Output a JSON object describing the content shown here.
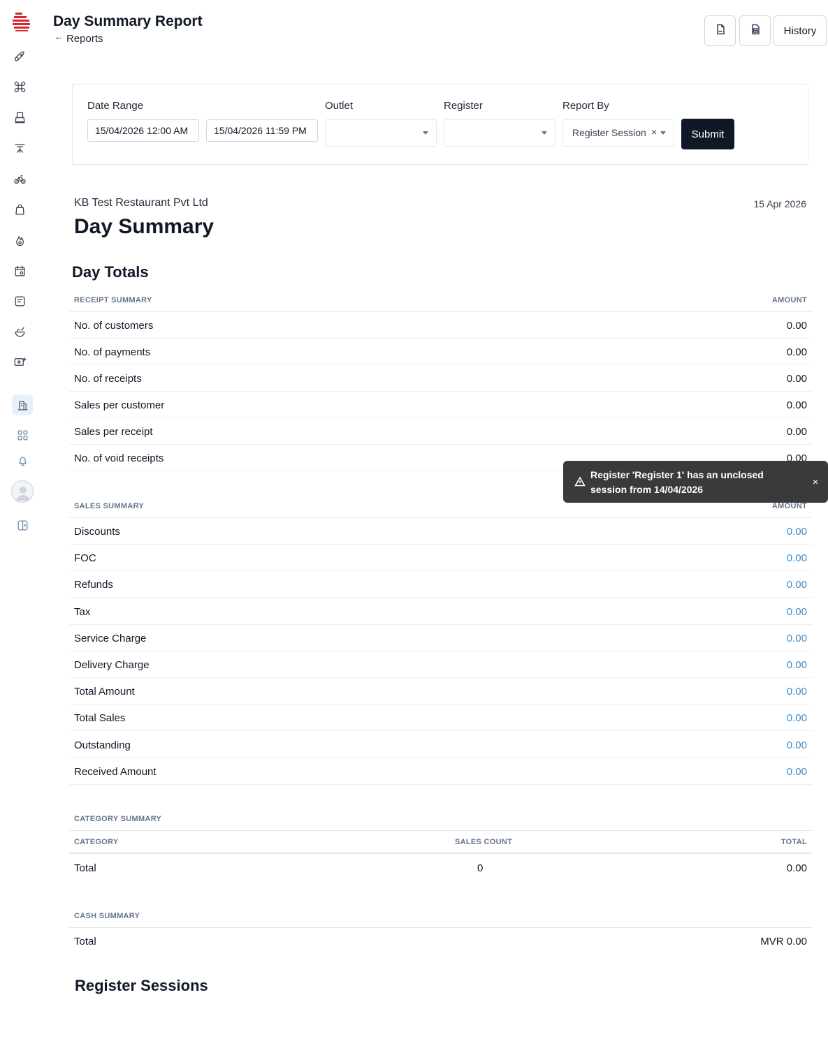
{
  "header": {
    "title": "Day Summary Report",
    "back_label": "Reports",
    "pdf_icon": "pdf-icon",
    "excel_icon": "spreadsheet-icon",
    "history_label": "History"
  },
  "filters": {
    "date_range_label": "Date Range",
    "date_from": "15/04/2026 12:00 AM",
    "date_to": "15/04/2026 11:59 PM",
    "outlet_label": "Outlet",
    "outlet_value": "",
    "register_label": "Register",
    "register_value": "",
    "report_by_label": "Report By",
    "report_by_value": "Register Session",
    "report_by_clear": "×",
    "submit_label": "Submit"
  },
  "report": {
    "company": "KB Test Restaurant Pvt Ltd",
    "date": "15 Apr 2026",
    "title": "Day Summary",
    "day_totals_title": "Day Totals"
  },
  "receipt_summary": {
    "header": "RECEIPT SUMMARY",
    "amount_header": "AMOUNT",
    "rows": [
      {
        "label": "No. of customers",
        "value": "0.00"
      },
      {
        "label": "No. of payments",
        "value": "0.00"
      },
      {
        "label": "No. of receipts",
        "value": "0.00"
      },
      {
        "label": "Sales per customer",
        "value": "0.00"
      },
      {
        "label": "Sales per receipt",
        "value": "0.00"
      },
      {
        "label": "No. of void receipts",
        "value": "0.00"
      }
    ]
  },
  "sales_summary": {
    "header": "SALES SUMMARY",
    "amount_header": "AMOUNT",
    "rows": [
      {
        "label": "Discounts",
        "value": "0.00"
      },
      {
        "label": "FOC",
        "value": "0.00"
      },
      {
        "label": "Refunds",
        "value": "0.00"
      },
      {
        "label": "Tax",
        "value": "0.00"
      },
      {
        "label": "Service Charge",
        "value": "0.00"
      },
      {
        "label": "Delivery Charge",
        "value": "0.00"
      },
      {
        "label": "Total Amount",
        "value": "0.00"
      },
      {
        "label": "Total Sales",
        "value": "0.00"
      },
      {
        "label": "Outstanding",
        "value": "0.00"
      },
      {
        "label": "Received Amount",
        "value": "0.00"
      }
    ]
  },
  "category_summary": {
    "header": "CATEGORY SUMMARY",
    "columns": [
      "CATEGORY",
      "SALES COUNT",
      "TOTAL"
    ],
    "total_row": {
      "label": "Total",
      "count": "0",
      "total": "0.00"
    }
  },
  "cash_summary": {
    "header": "CASH SUMMARY",
    "total_row": {
      "label": "Total",
      "value": "MVR 0.00"
    }
  },
  "register_sessions_title": "Register Sessions",
  "toast": {
    "message": "Register 'Register 1' has an unclosed session from 14/04/2026",
    "close": "×"
  },
  "sidebar": {
    "icons": [
      "rocket-icon",
      "command-icon",
      "register-icon",
      "table-icon",
      "bicycle-icon",
      "bag-icon",
      "flame-icon",
      "calendar-settings-icon",
      "receipt-icon",
      "food-bowl-icon",
      "money-settings-icon",
      "reports-icon",
      "apps-grid-icon",
      "bell-icon",
      "user-avatar",
      "collapse-sidebar-icon"
    ]
  },
  "colors": {
    "accent": "#101827",
    "link": "#3b8ed3",
    "brand": "#d7262e",
    "toast_bg": "#3a3a3a"
  }
}
